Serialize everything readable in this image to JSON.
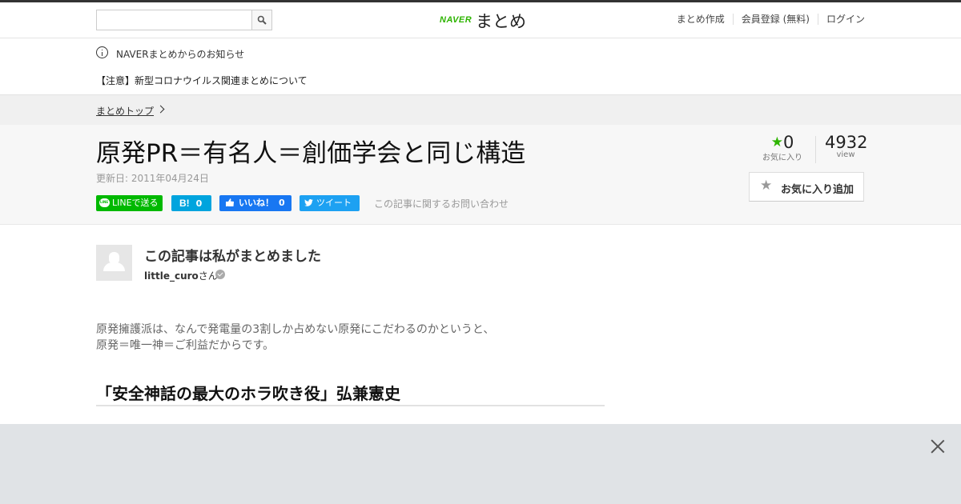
{
  "header": {
    "search_placeholder": "",
    "logo_naver": "NAVER",
    "logo_matome": "まとめ",
    "nav": [
      "まとめ作成",
      "会員登録 (無料)",
      "ログイン"
    ]
  },
  "notice": {
    "label": "NAVERまとめからのお知らせ",
    "link": "【注意】新型コロナウイルス関連まとめについて"
  },
  "breadcrumb": {
    "top": "まとめトップ"
  },
  "article": {
    "title": "原発PR＝有名人＝創価学会と同じ構造",
    "updated": "更新日: 2011年04月24日",
    "favorites": "0",
    "favorites_label": "お気に入り",
    "views": "4932",
    "views_label": "view",
    "fav_button": "お気に入り追加",
    "contact": "この記事に関するお問い合わせ"
  },
  "share": {
    "line": "LINEで送る",
    "hatena_icon": "B!",
    "hatena_count": "0",
    "fb_label": "いいね！",
    "fb_count": "0",
    "tweet": "ツイート"
  },
  "author": {
    "heading": "この記事は私がまとめました",
    "username": "little_curo",
    "suffix": "さん"
  },
  "content": {
    "paragraph_line1": "原発擁護派は、なんで発電量の3割しか占めない原発にこだわるのかというと、",
    "paragraph_line2": "原発＝唯一神＝ご利益だからです。",
    "section_heading": "「安全神話の最大のホラ吹き役」弘兼憲史"
  },
  "colors": {
    "naver_green": "#2db400",
    "line_green": "#00b900",
    "hatena_blue": "#00a4de",
    "facebook_blue": "#1877f2",
    "twitter_blue": "#1da1f2"
  }
}
